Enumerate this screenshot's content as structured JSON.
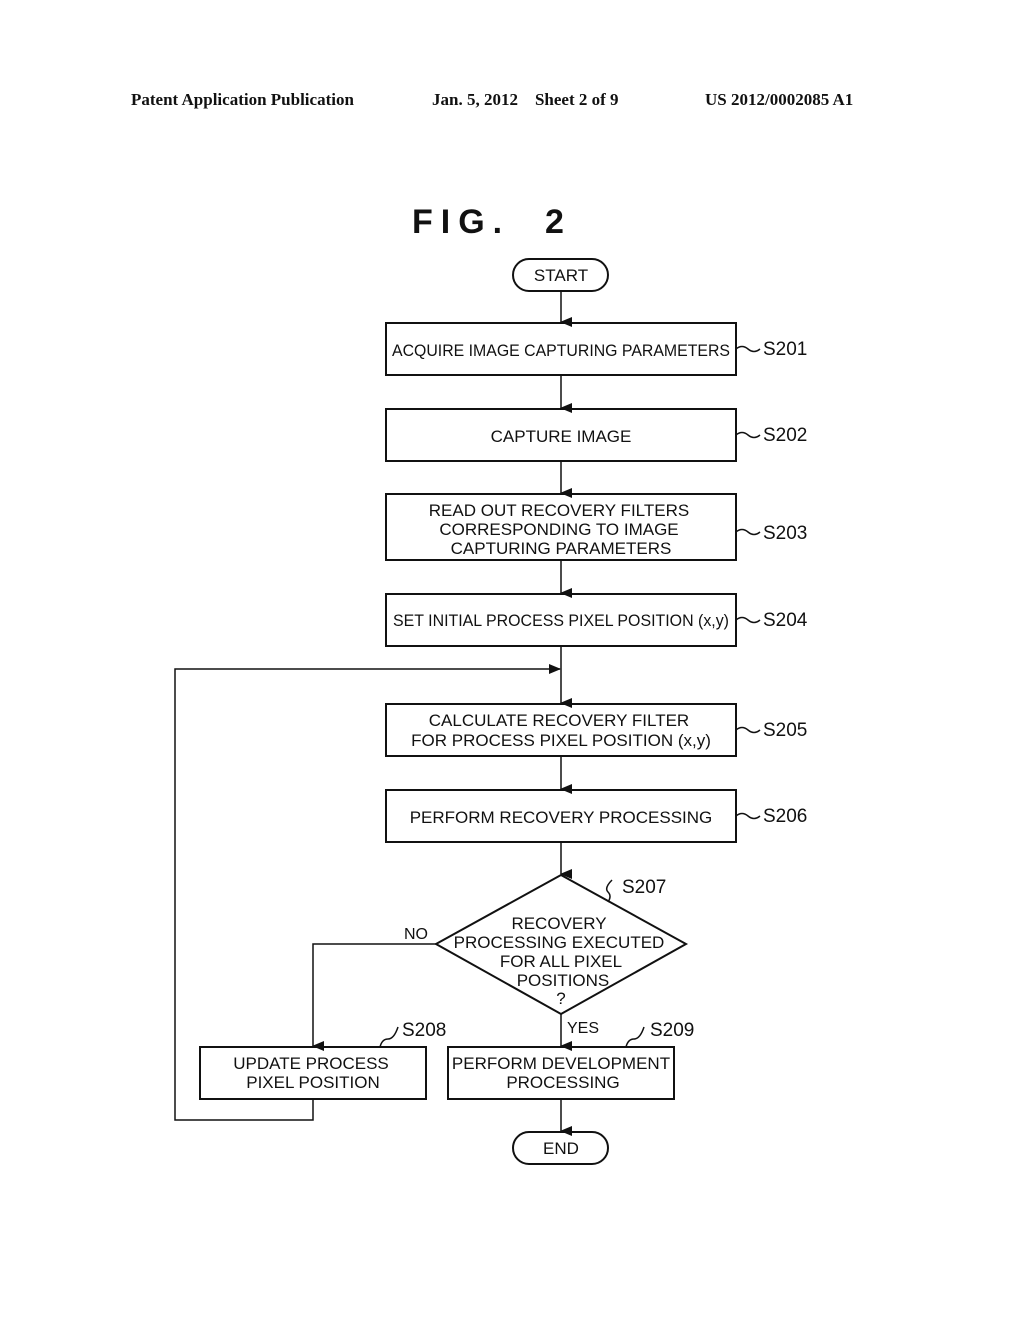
{
  "header": {
    "left": "Patent Application Publication",
    "date_sheet": "Jan. 5, 2012    Sheet 2 of 9",
    "number": "US 2012/0002085 A1"
  },
  "figure_title": "FIG.  2",
  "flowchart": {
    "start": "START",
    "end": "END",
    "steps": [
      {
        "id": "S201",
        "lines": [
          "ACQUIRE IMAGE CAPTURING PARAMETERS"
        ]
      },
      {
        "id": "S202",
        "lines": [
          "CAPTURE IMAGE"
        ]
      },
      {
        "id": "S203",
        "lines": [
          "READ OUT RECOVERY FILTERS",
          "CORRESPONDING TO IMAGE",
          "CAPTURING PARAMETERS"
        ]
      },
      {
        "id": "S204",
        "lines": [
          "SET INITIAL PROCESS PIXEL POSITION (x,y)"
        ]
      },
      {
        "id": "S205",
        "lines": [
          "CALCULATE RECOVERY FILTER",
          "FOR PROCESS PIXEL POSITION (x,y)"
        ]
      },
      {
        "id": "S206",
        "lines": [
          "PERFORM RECOVERY PROCESSING"
        ]
      }
    ],
    "decision": {
      "id": "S207",
      "lines": [
        "RECOVERY",
        "PROCESSING EXECUTED",
        "FOR ALL PIXEL",
        "POSITIONS",
        "?"
      ],
      "no_label": "NO",
      "yes_label": "YES"
    },
    "branch_no": {
      "id": "S208",
      "lines": [
        "UPDATE PROCESS",
        "PIXEL POSITION"
      ]
    },
    "branch_yes": {
      "id": "S209",
      "lines": [
        "PERFORM DEVELOPMENT",
        "PROCESSING"
      ]
    }
  }
}
